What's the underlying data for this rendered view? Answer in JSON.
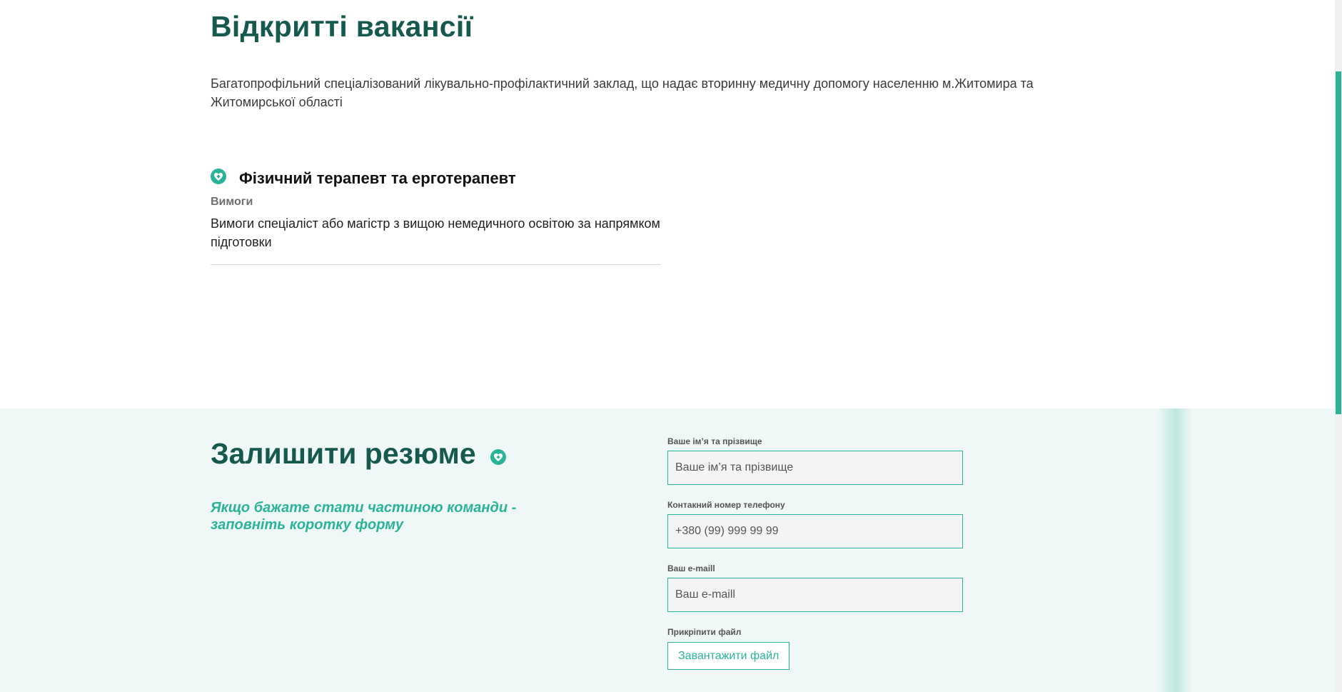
{
  "vacancies": {
    "title": "Відкритті вакансії",
    "intro": "Багатопрофільний спеціалізований лікувально-профілактичний заклад, що надає вторинну медичну допомогу населенню м.Житомира та Житомирської області",
    "jobs": [
      {
        "icon": "heart-icon",
        "title": "Фізичний терапевт та ерготерапевт",
        "requirements_label": "Вимоги",
        "requirements_text": "Вимоги спеціаліст або магістр з вищою немедичного освітою за напрямком підготовки"
      }
    ]
  },
  "resume": {
    "title": "Залишити резюме",
    "icon": "heart-icon",
    "subtitle": "Якщо бажате стати частиною команди - заповніть коротку форму",
    "form": {
      "name_label": "Ваше ім’я та прізвище",
      "name_placeholder": "Ваше ім’я та прізвище",
      "phone_label": "Контакний номер телефону",
      "phone_placeholder": "+380 (99) 999 99 99",
      "email_label": "Ваш e-maill",
      "email_placeholder": "Ваш e-maill",
      "file_label": "Прикріпити файл",
      "upload_button": "Завантажити файл"
    }
  },
  "colors": {
    "heading": "#165a4f",
    "accent": "#2bb39a",
    "section_bg": "#eff8f6",
    "input_bg": "#f4f4f4"
  }
}
